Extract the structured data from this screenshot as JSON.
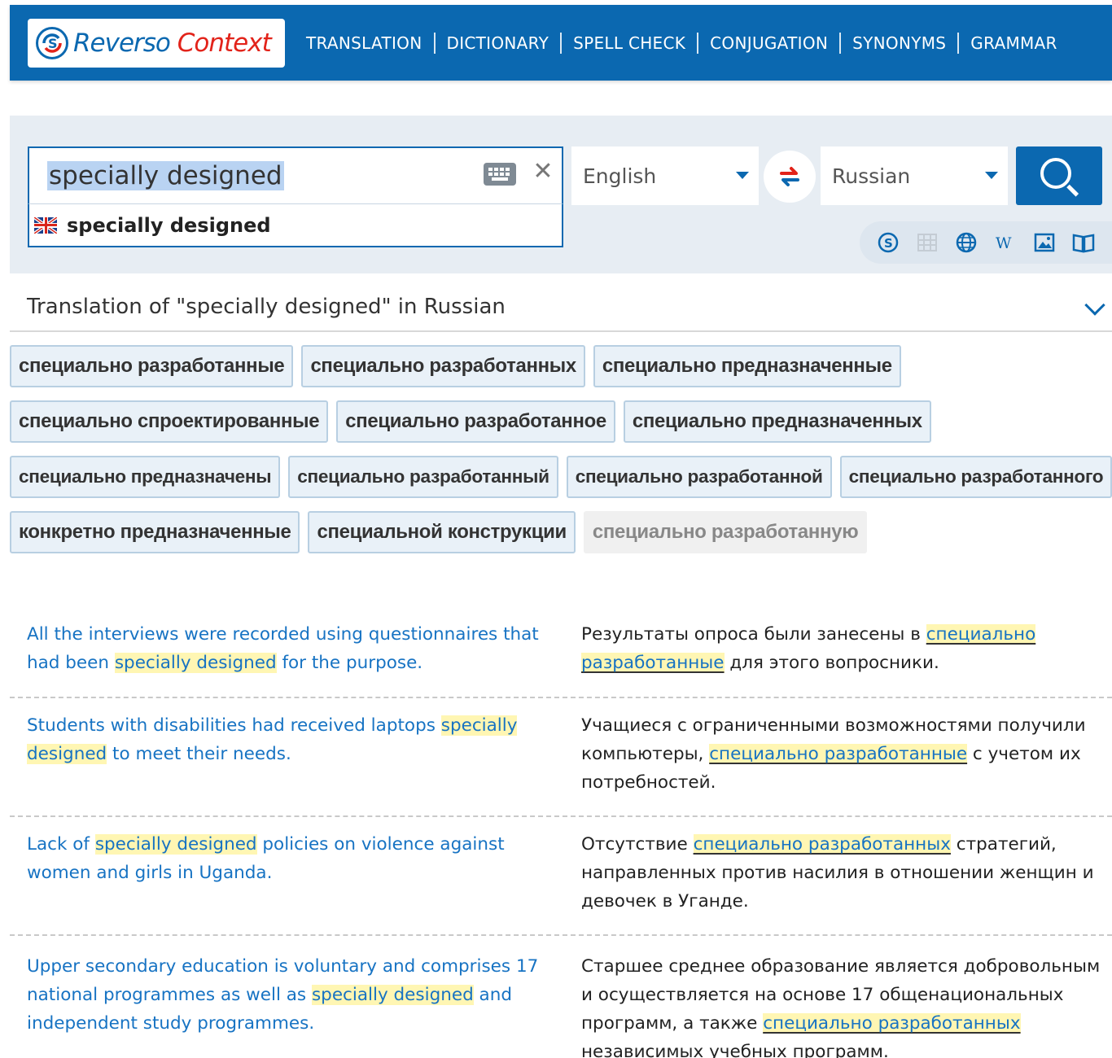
{
  "header": {
    "logo_reverso": "Reverso",
    "logo_context": "Context",
    "nav": [
      "TRANSLATION",
      "DICTIONARY",
      "SPELL CHECK",
      "CONJUGATION",
      "SYNONYMS",
      "GRAMMAR"
    ]
  },
  "search": {
    "query": "specially designed",
    "suggestion": "specially designed",
    "source_lang": "English",
    "target_lang": "Russian"
  },
  "tools": [
    "skype-icon",
    "table-icon",
    "globe-icon",
    "wikipedia-icon",
    "image-icon",
    "book-icon"
  ],
  "translation": {
    "title": "Translation of \"specially designed\" in Russian",
    "rows": [
      [
        "специально разработанные",
        "специально разработанных",
        "специально предназначенные"
      ],
      [
        "специально спроектированные",
        "специально разработанное",
        "специально предназначенных"
      ],
      [
        "специально предназначены",
        "специально разработанный",
        "специально разработанной",
        "специально разработанного"
      ],
      [
        "конкретно предназначенные",
        "специальной конструкции",
        "специально разработанную"
      ]
    ]
  },
  "examples": [
    {
      "src": [
        "All the interviews were recorded using questionnaires that had been ",
        "specially designed",
        " for the purpose."
      ],
      "tgt": [
        "Результаты опроса были занесены в ",
        "специально разработанные",
        " для этого вопросники."
      ]
    },
    {
      "src": [
        "Students with disabilities had received laptops ",
        "specially designed",
        " to meet their needs."
      ],
      "tgt": [
        "Учащиеся с ограниченными возможностями получили компьютеры, ",
        "специально разработанные",
        " с учетом их потребностей."
      ]
    },
    {
      "src": [
        "Lack of ",
        "specially designed",
        " policies on violence against women and girls in Uganda."
      ],
      "tgt": [
        "Отсутствие ",
        "специально разработанных",
        " стратегий, направленных против насилия в отношении женщин и девочек в Уганде."
      ]
    },
    {
      "src": [
        "Upper secondary education is voluntary and comprises 17 national programmes as well as ",
        "specially designed",
        " and independent study programmes."
      ],
      "tgt": [
        "Старшее среднее образование является добровольным и осуществляется на основе 17 общенациональных программ, а также ",
        "специально разработанных",
        " независимых учебных программ."
      ]
    }
  ],
  "colors": {
    "brand_blue": "#0b68b0",
    "brand_red": "#e2231a",
    "link_blue": "#1773c3",
    "highlight": "#fff6b3"
  }
}
